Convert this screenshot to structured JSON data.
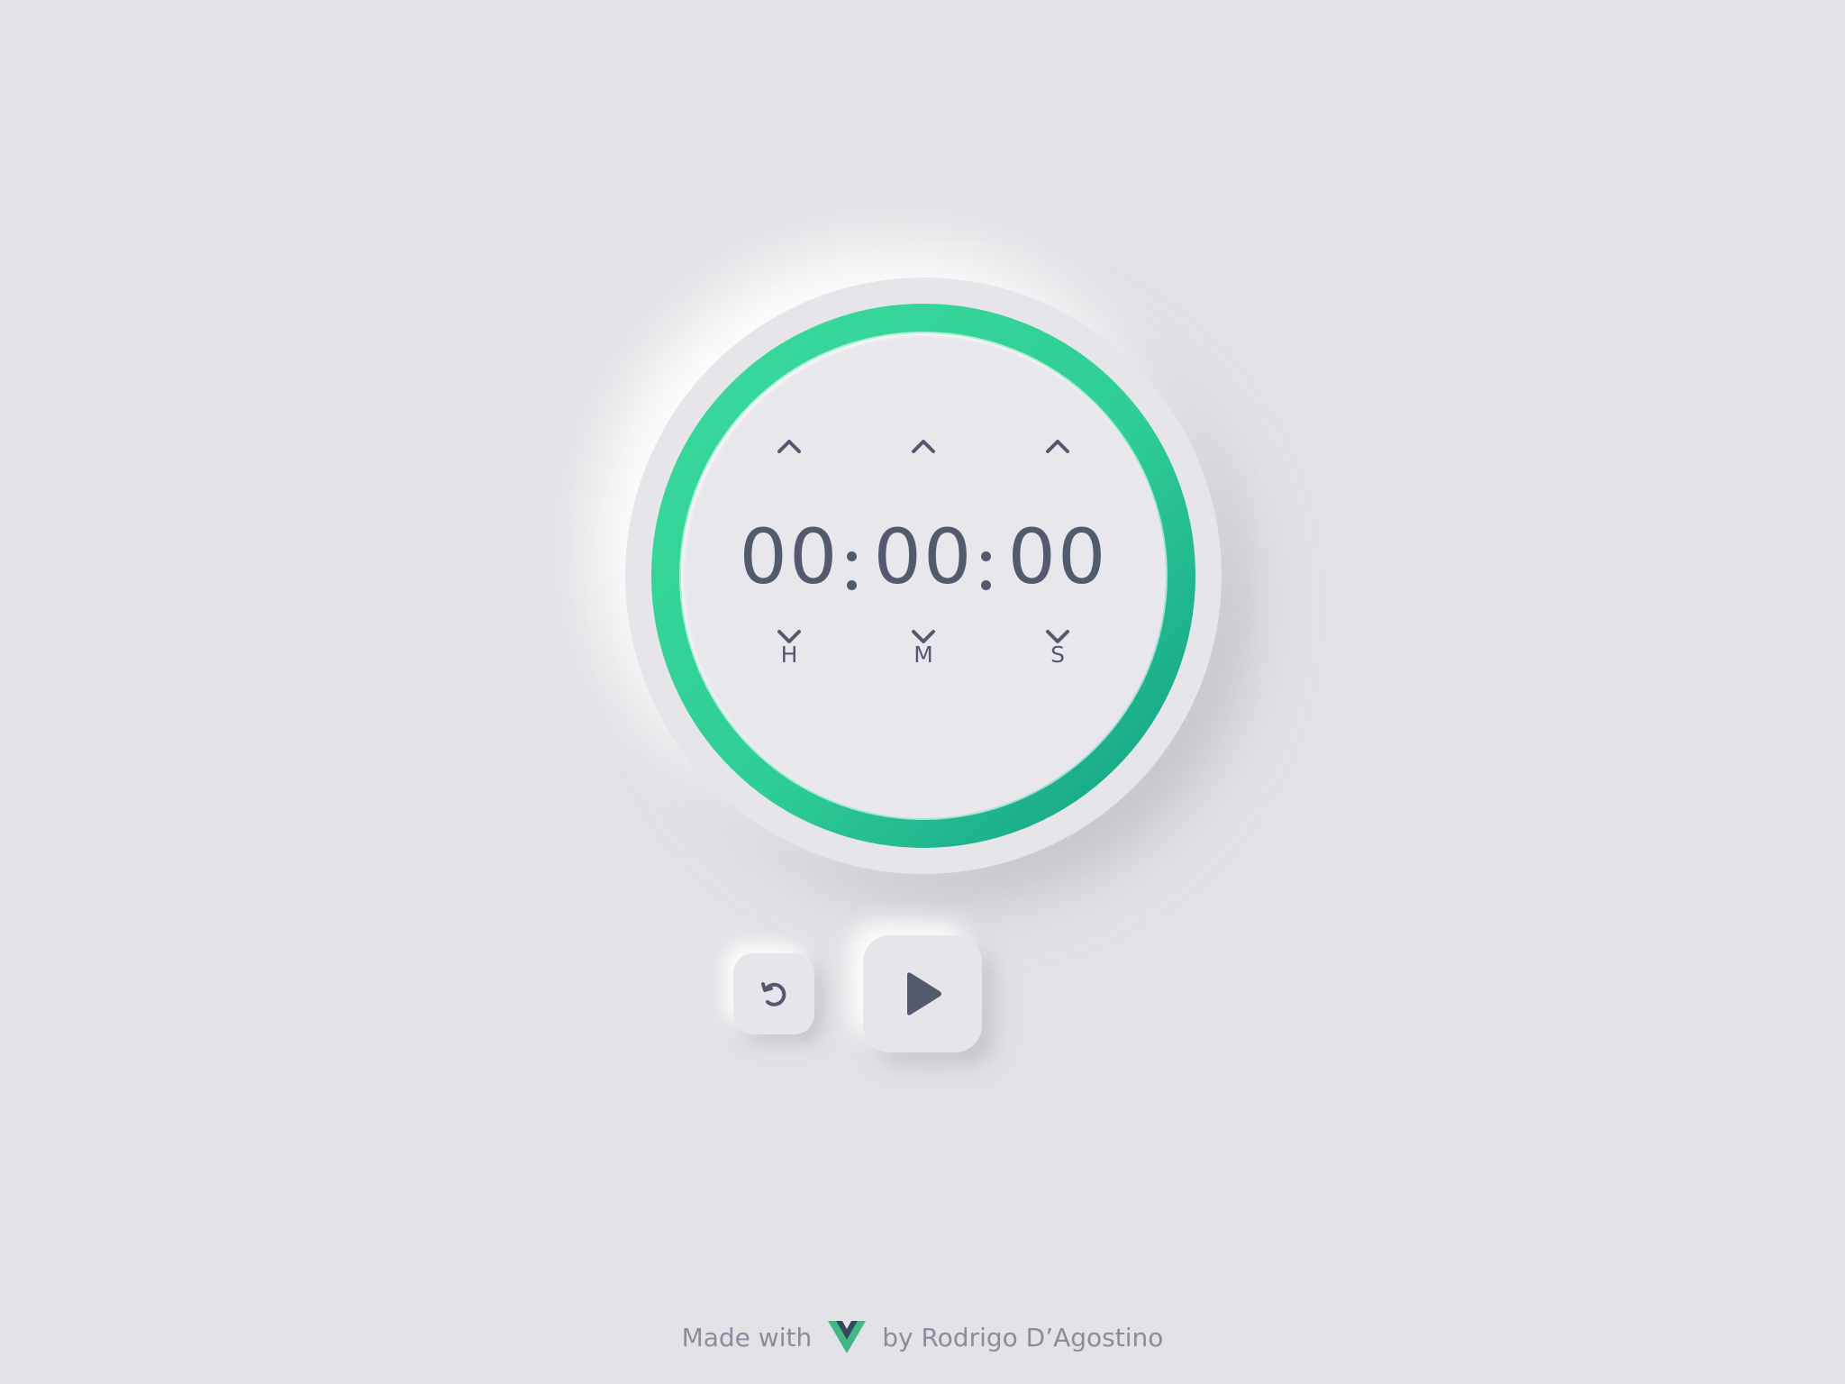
{
  "timer": {
    "hours": "00",
    "minutes": "00",
    "seconds": "00",
    "hours_label": "H",
    "minutes_label": "M",
    "seconds_label": "S",
    "ring_progress": 1.0
  },
  "controls": {
    "reset_icon": "rotate-ccw-icon",
    "play_icon": "play-icon"
  },
  "footer": {
    "made_with": "Made with",
    "logo_icon": "vue-logo-icon",
    "author": "by Rodrigo D’Agostino"
  },
  "colors": {
    "background": "#e3e3e7",
    "ring_start": "#3ad99b",
    "ring_end": "#12a085",
    "text": "#545a6d",
    "footer_text": "#8a8d9c",
    "vue_green": "#41b883",
    "vue_dark": "#35495e"
  }
}
